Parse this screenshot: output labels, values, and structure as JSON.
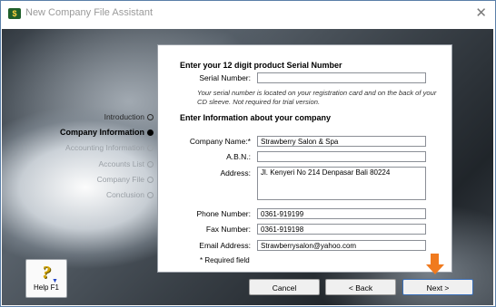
{
  "window": {
    "title": "New Company File Assistant",
    "close_glyph": "✕"
  },
  "steps": [
    {
      "label": "Introduction",
      "state": "done"
    },
    {
      "label": "Company Information",
      "state": "active"
    },
    {
      "label": "Accounting Information",
      "state": "future"
    },
    {
      "label": "Accounts List",
      "state": "future"
    },
    {
      "label": "Company File",
      "state": "future"
    },
    {
      "label": "Conclusion",
      "state": "future"
    }
  ],
  "serial": {
    "heading": "Enter your 12 digit product Serial Number",
    "label": "Serial Number:",
    "value": "",
    "note": "Your serial number is located on your registration card and on the back of your CD sleeve. Not required for trial version."
  },
  "company": {
    "heading": "Enter Information about your company",
    "name_label": "Company Name:*",
    "name_value": "Strawberry Salon & Spa",
    "abn_label": "A.B.N.:",
    "abn_value": "",
    "address_label": "Address:",
    "address_value": "Jl. Kenyeri No 214 Denpasar Bali 80224",
    "phone_label": "Phone Number:",
    "phone_value": "0361-919199",
    "fax_label": "Fax Number:",
    "fax_value": "0361-919198",
    "email_label": "Email Address:",
    "email_value": "Strawberrysalon@yahoo.com",
    "required_note": "* Required field"
  },
  "buttons": {
    "help": "Help F1",
    "cancel": "Cancel",
    "back": "< Back",
    "next": "Next >"
  },
  "icons": {
    "help": "help-question-icon",
    "pointer": "orange-down-arrow-icon"
  },
  "colors": {
    "pointer_arrow": "#f07a1e",
    "help_icon": "#d4a400"
  }
}
